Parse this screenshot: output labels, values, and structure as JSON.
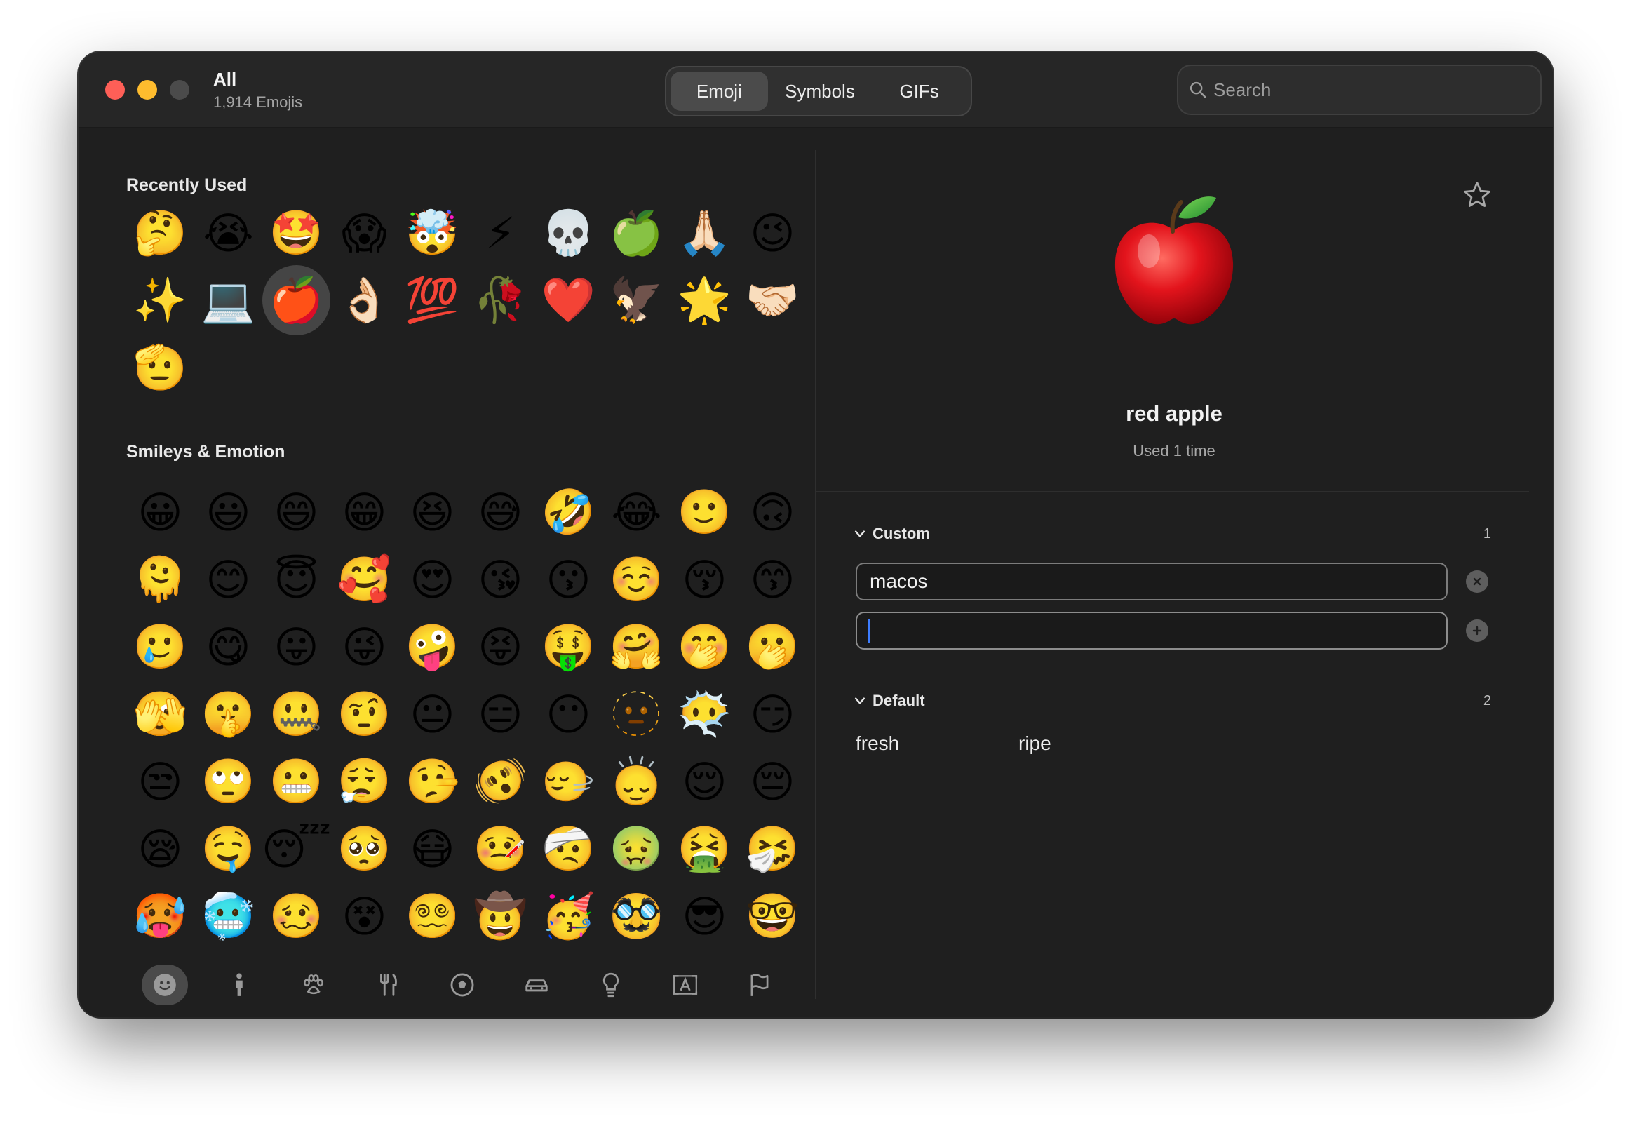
{
  "window": {
    "title": "All",
    "subtitle": "1,914 Emojis"
  },
  "tabs": [
    {
      "label": "Emoji",
      "active": true
    },
    {
      "label": "Symbols",
      "active": false
    },
    {
      "label": "GIFs",
      "active": false
    }
  ],
  "search": {
    "placeholder": "Search",
    "value": ""
  },
  "sections": {
    "recent": {
      "title": "Recently Used",
      "emojis": [
        "🤔",
        "😭",
        "🤩",
        "😱",
        "🤯",
        "⚡",
        "💀",
        "🍏",
        "🙏🏻",
        "😉",
        "✨",
        "💻",
        "🍎",
        "👌🏻",
        "💯",
        "🥀",
        "❤️",
        "🦅",
        "🌟",
        "🤝🏻",
        "🫡"
      ],
      "selected_index": 12
    },
    "smileys": {
      "title": "Smileys & Emotion",
      "emojis": [
        "😀",
        "😃",
        "😄",
        "😁",
        "😆",
        "😅",
        "🤣",
        "😂",
        "🙂",
        "🙃",
        "🫠",
        "😊",
        "😇",
        "🥰",
        "😍",
        "😘",
        "😗",
        "☺️",
        "😚",
        "😙",
        "🥲",
        "😋",
        "😛",
        "😜",
        "🤪",
        "😝",
        "🤑",
        "🤗",
        "🤭",
        "🫢",
        "🫣",
        "🤫",
        "🤐",
        "🤨",
        "😐",
        "😑",
        "😶",
        "🫥",
        "😶‍🌫️",
        "😏",
        "😒",
        "🙄",
        "😬",
        "😮‍💨",
        "🤥",
        "🫨",
        "🙂‍↔️",
        "🙂‍↕️",
        "😌",
        "😔",
        "😪",
        "🤤",
        "😴",
        "🥺",
        "😷",
        "🤒",
        "🤕",
        "🤢",
        "🤮",
        "🤧",
        "🥵",
        "🥶",
        "🥴",
        "😵",
        "😵‍💫",
        "🤠",
        "🥳",
        "🥸",
        "😎",
        "🤓"
      ]
    }
  },
  "categories": [
    {
      "name": "smileys",
      "icon": "smiley-icon",
      "active": true
    },
    {
      "name": "people",
      "icon": "person-icon",
      "active": false
    },
    {
      "name": "animals",
      "icon": "paw-icon",
      "active": false
    },
    {
      "name": "food",
      "icon": "fork-knife-icon",
      "active": false
    },
    {
      "name": "activity",
      "icon": "ball-icon",
      "active": false
    },
    {
      "name": "travel",
      "icon": "car-icon",
      "active": false
    },
    {
      "name": "objects",
      "icon": "lightbulb-icon",
      "active": false
    },
    {
      "name": "symbols",
      "icon": "symbol-a-icon",
      "active": false
    },
    {
      "name": "flags",
      "icon": "flag-icon",
      "active": false
    }
  ],
  "detail": {
    "emoji": "🍎",
    "name": "red apple",
    "usage": "Used 1 time",
    "custom": {
      "label": "Custom",
      "count": "1",
      "keywords": [
        "macos"
      ],
      "new_value": ""
    },
    "default": {
      "label": "Default",
      "count": "2",
      "keywords": [
        "fresh",
        "ripe"
      ]
    }
  },
  "colors": {
    "window_bg": "#1f1f1f",
    "caret": "#3d7dff"
  }
}
